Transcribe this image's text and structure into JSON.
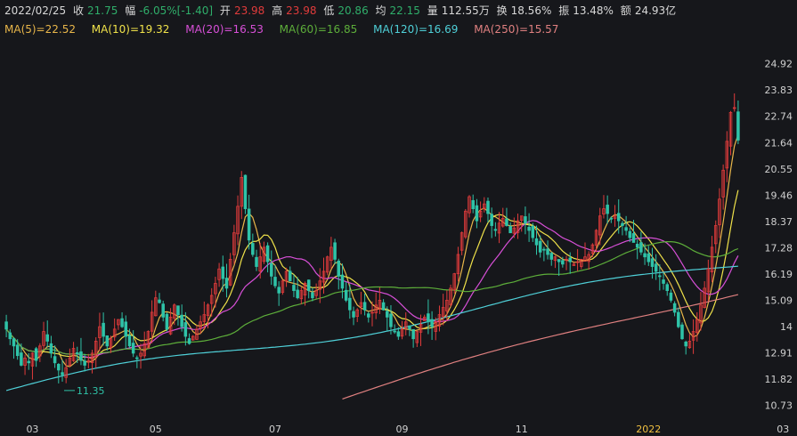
{
  "info": {
    "date": "2022/02/25",
    "close_label": "收",
    "close": "21.75",
    "change_label": "幅",
    "change": "-6.05%[-1.40]",
    "open_label": "开",
    "open": "23.98",
    "high_label": "高",
    "high": "23.98",
    "low_label": "低",
    "low": "20.86",
    "avg_label": "均",
    "avg": "22.15",
    "volume_label": "量",
    "volume": "112.55万",
    "turnover_label": "换",
    "turnover": "18.56%",
    "amplitude_label": "振",
    "amplitude": "13.48%",
    "amount_label": "额",
    "amount": "24.93亿"
  },
  "ma": [
    {
      "label": "MA(5)=22.52",
      "color": "#e8b64a"
    },
    {
      "label": "MA(10)=19.32",
      "color": "#f0e24a"
    },
    {
      "label": "MA(20)=16.53",
      "color": "#d74fd7"
    },
    {
      "label": "MA(60)=16.85",
      "color": "#5dae3a"
    },
    {
      "label": "MA(120)=16.69",
      "color": "#4fd0d8"
    },
    {
      "label": "MA(250)=15.57",
      "color": "#e08080"
    }
  ],
  "colors": {
    "up": "#e03b3b",
    "down": "#2fc3a8",
    "bg": "#16171b",
    "axis_text": "#d0d0d0"
  },
  "chart_data": {
    "type": "candlestick",
    "ylim": [
      10.2,
      25.5
    ],
    "y_ticks": [
      "24.92",
      "23.83",
      "22.74",
      "21.64",
      "20.55",
      "19.46",
      "18.37",
      "17.28",
      "16.19",
      "15.09",
      "14",
      "12.91",
      "11.82",
      "10.73"
    ],
    "x_ticks": [
      "03",
      "05",
      "07",
      "09",
      "11",
      "2022",
      "03"
    ],
    "annotations": [
      {
        "text": "24.92",
        "role": "high",
        "x_index": 216,
        "value": 24.92
      },
      {
        "text": "11.35",
        "role": "low",
        "x_index": 15,
        "value": 11.35
      }
    ],
    "close_series": [
      13.9,
      13.5,
      13.2,
      12.8,
      12.4,
      12.7,
      12.5,
      12.9,
      12.6,
      13.2,
      13.8,
      13.4,
      12.9,
      12.5,
      12.2,
      12.0,
      12.3,
      12.7,
      13.1,
      12.9,
      12.6,
      12.4,
      12.6,
      12.9,
      13.4,
      14.0,
      13.6,
      13.2,
      13.5,
      13.9,
      14.3,
      14.0,
      13.6,
      13.2,
      12.9,
      12.7,
      12.9,
      13.3,
      13.8,
      14.6,
      15.2,
      15.0,
      14.4,
      13.9,
      14.4,
      14.9,
      14.5,
      14.0,
      13.6,
      13.3,
      13.6,
      13.9,
      14.2,
      14.5,
      14.9,
      15.3,
      15.8,
      16.4,
      16.0,
      15.6,
      16.8,
      17.9,
      19.0,
      20.2,
      18.9,
      17.6,
      17.0,
      16.5,
      16.9,
      17.3,
      16.7,
      16.1,
      15.7,
      15.4,
      15.9,
      16.3,
      15.9,
      15.5,
      15.2,
      15.5,
      15.8,
      15.5,
      15.2,
      15.5,
      15.9,
      16.3,
      16.9,
      17.3,
      16.8,
      16.1,
      15.6,
      15.1,
      14.7,
      14.4,
      14.7,
      15.0,
      14.7,
      14.4,
      14.6,
      14.9,
      15.1,
      14.7,
      14.4,
      14.0,
      13.8,
      13.6,
      13.9,
      14.2,
      13.9,
      13.5,
      13.8,
      14.1,
      14.4,
      14.2,
      14.0,
      14.2,
      14.5,
      14.8,
      15.1,
      15.6,
      16.2,
      17.0,
      17.9,
      18.8,
      19.4,
      18.9,
      18.4,
      18.8,
      19.1,
      18.7,
      18.2,
      18.0,
      18.3,
      18.5,
      18.2,
      17.9,
      18.1,
      18.4,
      18.6,
      18.3,
      18.0,
      17.7,
      17.4,
      17.1,
      17.2,
      17.0,
      16.8,
      16.9,
      16.7,
      16.6,
      16.8,
      16.7,
      16.6,
      16.7,
      16.8,
      16.9,
      17.0,
      17.4,
      18.0,
      18.6,
      18.9,
      18.7,
      18.5,
      18.6,
      18.4,
      18.2,
      18.0,
      17.7,
      17.5,
      17.3,
      17.1,
      16.9,
      16.7,
      16.5,
      16.3,
      16.1,
      15.8,
      15.5,
      15.1,
      14.6,
      14.0,
      13.5,
      13.2,
      13.4,
      13.8,
      14.3,
      14.9,
      15.6,
      16.4,
      17.3,
      18.2,
      19.3,
      20.5,
      21.7,
      22.9,
      23.1,
      21.75
    ]
  },
  "ma_series": {
    "ma5_end": 22.52,
    "ma10_end": 19.32,
    "ma20_end": 16.53,
    "ma60_end": 16.85,
    "ma120_end": 16.69,
    "ma250_end": 15.57
  }
}
